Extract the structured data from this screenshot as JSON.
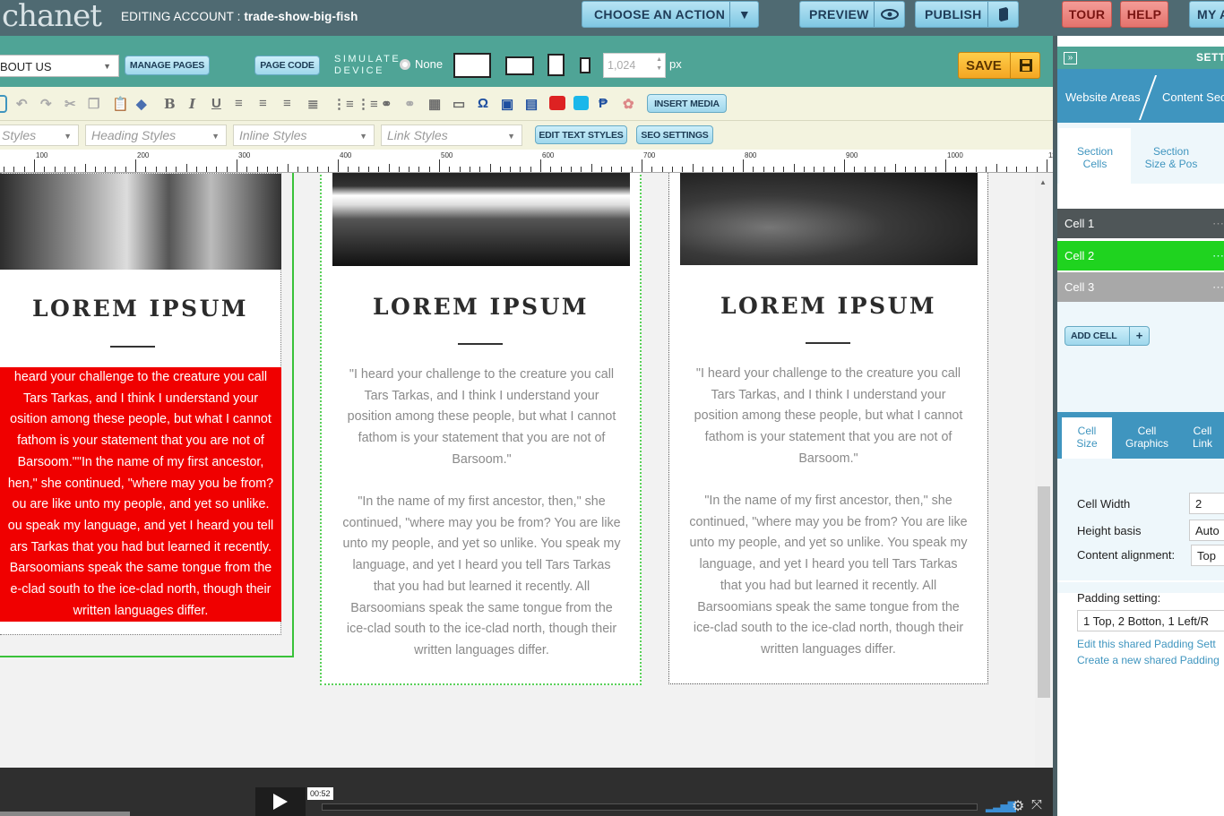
{
  "header": {
    "logo": "chanet",
    "editing_label": "EDITING ACCOUNT :",
    "account_name": "trade-show-big-fish",
    "choose_action": "CHOOSE AN ACTION",
    "preview": "PREVIEW",
    "publish": "PUBLISH",
    "tour": "TOUR",
    "help": "HELP",
    "my": "MY A"
  },
  "toolbar": {
    "page_select": "BOUT US",
    "manage_pages": "MANAGE PAGES",
    "page_code": "PAGE CODE",
    "simulate_line1": "SIMULATE",
    "simulate_line2": "DEVICE",
    "none_label": "None",
    "width_value": "1,024",
    "px": "px",
    "save": "SAVE",
    "insert_media": "INSERT MEDIA",
    "styles_dd": "Styles",
    "heading_styles": "Heading Styles",
    "inline_styles": "Inline Styles",
    "link_styles": "Link Styles",
    "edit_text_styles": "EDIT TEXT STYLES",
    "seo_settings": "SEO SETTINGS"
  },
  "ruler_labels": [
    "100",
    "200",
    "300",
    "400",
    "500",
    "600",
    "700",
    "800",
    "900",
    "1000",
    "1100"
  ],
  "cards": [
    {
      "title": "LOREM IPSUM",
      "lines": [
        " heard your challenge to the creature you call",
        "Tars Tarkas, and I think I understand your",
        "osition among these people, but what I cannot",
        "fathom is your statement that you are not of",
        "Barsoom.\"\"In the name of my first ancestor,",
        "hen,\" she continued, \"where may you be from?",
        "ou are like unto my people, and yet so unlike.",
        "ou speak my language, and yet I heard you tell",
        "ars Tarkas that you had but learned it recently.",
        "Barsoomians speak the same tongue from the",
        "e-clad south to the ice-clad north, though their",
        "written languages differ."
      ]
    },
    {
      "title": "LOREM IPSUM",
      "para1": [
        "\"I heard your challenge to the creature you call",
        "Tars Tarkas, and I think I understand your",
        "position among these people, but what I cannot",
        "fathom is your statement that you are not of",
        "Barsoom.\""
      ],
      "para2": [
        "\"In the name of my first ancestor, then,\" she",
        "continued, \"where may you be from? You are like",
        "unto my people, and yet so unlike. You speak my",
        "language, and yet I heard you tell Tars Tarkas",
        "that you had but learned it recently. All",
        "Barsoomians speak the same tongue from the",
        "ice-clad south to the ice-clad north, though their",
        "written languages differ."
      ]
    },
    {
      "title": "LOREM IPSUM",
      "para1": [
        "\"I heard your challenge to the creature you call",
        "Tars Tarkas, and I think I understand your",
        "position among these people, but what I cannot",
        "fathom is your statement that you are not of",
        "Barsoom.\""
      ],
      "para2": [
        "\"In the name of my first ancestor, then,\" she",
        "continued, \"where may you be from? You are like",
        "unto my people, and yet so unlike. You speak my",
        "language, and yet I heard you tell Tars Tarkas",
        "that you had but learned it recently. All",
        "Barsoomians speak the same tongue from the",
        "ice-clad south to the ice-clad north, though their",
        "written languages differ."
      ]
    }
  ],
  "video": {
    "time": "00:52"
  },
  "panel": {
    "settings": "SETT",
    "website_areas": "Website Areas",
    "content_sec": "Content Sec",
    "section_cells_1": "Section",
    "section_cells_2": "Cells",
    "section_size_1": "Section",
    "section_size_2": "Size & Pos",
    "cells": [
      "Cell 1",
      "Cell 2",
      "Cell 3"
    ],
    "add_cell": "ADD CELL",
    "cell_size_1": "Cell",
    "cell_size_2": "Size",
    "cell_graphics_1": "Cell",
    "cell_graphics_2": "Graphics",
    "cell_link_1": "Cell",
    "cell_link_2": "Link",
    "cell_width_label": "Cell Width",
    "cell_width_value": "2",
    "height_basis_label": "Height basis",
    "height_basis_value": "Auto",
    "content_alignment_label": "Content alignment:",
    "content_alignment_value": "Top",
    "padding_label": "Padding setting:",
    "padding_value": "1 Top, 2 Botton, 1 Left/R",
    "edit_padding": "Edit this shared Padding Sett",
    "create_padding": "Create a new shared Padding"
  },
  "colors": {
    "teal": "#4fa496",
    "selected_cell": "#1fd31f",
    "red_block": "#f00000"
  }
}
